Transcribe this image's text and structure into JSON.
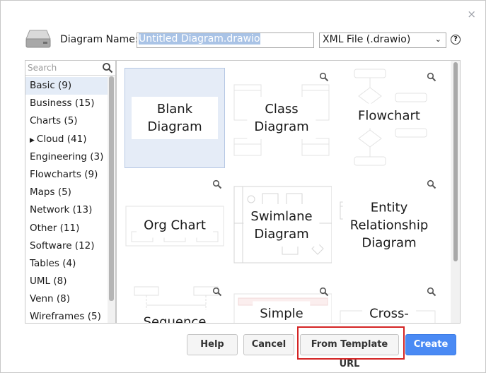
{
  "dialog": {
    "close_glyph": "×",
    "drive_icon": "drive-icon",
    "name_label": "Diagram Name:",
    "name_value": "Untitled Diagram.drawio",
    "format_value": "XML File (.drawio)",
    "help_glyph": "?"
  },
  "sidebar": {
    "search_placeholder": "Search",
    "categories": [
      {
        "label": "Basic (9)",
        "active": true
      },
      {
        "label": "Business (15)"
      },
      {
        "label": "Charts (5)"
      },
      {
        "label": "Cloud (41)",
        "expandable": true
      },
      {
        "label": "Engineering (3)"
      },
      {
        "label": "Flowcharts (9)"
      },
      {
        "label": "Maps (5)"
      },
      {
        "label": "Network (13)"
      },
      {
        "label": "Other (11)"
      },
      {
        "label": "Software (12)"
      },
      {
        "label": "Tables (4)"
      },
      {
        "label": "UML (8)"
      },
      {
        "label": "Venn (8)"
      },
      {
        "label": "Wireframes (5)"
      }
    ]
  },
  "templates": [
    {
      "line1": "Blank",
      "line2": "Diagram"
    },
    {
      "line1": "Class",
      "line2": "Diagram"
    },
    {
      "line1": "Flowchart",
      "line2": ""
    },
    {
      "line1": "Org Chart",
      "line2": ""
    },
    {
      "line1": "Swimlane",
      "line2": "Diagram"
    },
    {
      "line1": "Entity",
      "line2": "Relationship",
      "line3": "Diagram"
    },
    {
      "line1": "Sequence",
      "line2": ""
    },
    {
      "line1": "Simple",
      "line2": ""
    },
    {
      "line1": "Cross-",
      "line2": ""
    }
  ],
  "buttons": {
    "help": "Help",
    "cancel": "Cancel",
    "template_url": "From Template URL",
    "create": "Create"
  },
  "colors": {
    "primary": "#4a8af4",
    "selected_tile": "#e5ecf7",
    "highlight": "#d42424"
  }
}
